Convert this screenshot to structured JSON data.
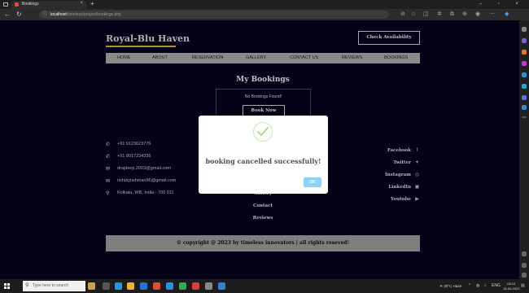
{
  "browser": {
    "tab_title": "Bookings",
    "tab_close": "×",
    "new_tab": "+",
    "window_controls": "– ▫ ×",
    "url_host": "localhost",
    "url_path": "/timeless/project/bookings.php",
    "url_info_icon": "info-icon"
  },
  "site": {
    "brand": "Royal-Blu Haven",
    "check_availability": "Check Availability",
    "nav": [
      "HOME",
      "ABOUT",
      "RESERVATION",
      "GALLERY",
      "CONTACT US",
      "REVIEWS",
      "BOOKINGS"
    ],
    "heading": "My Bookings",
    "no_bookings": "No Bookings Found!",
    "book_now": "Book Now",
    "contact": [
      {
        "icon": "phone-icon",
        "text": "+91 9123623776"
      },
      {
        "icon": "phone-icon",
        "text": "+91 8017234356"
      },
      {
        "icon": "mail-icon",
        "text": "drajdeep.2003@gmail.com"
      },
      {
        "icon": "mail-icon",
        "text": "rishiayushman96@gmail.com"
      },
      {
        "icon": "location-icon",
        "text": "Kolkata, WB, India - 700 011"
      }
    ],
    "footer_links": [
      "Gallery",
      "Contact",
      "Reviews"
    ],
    "social": [
      {
        "label": "Facebook",
        "icon": "facebook-icon"
      },
      {
        "label": "Twitter",
        "icon": "twitter-icon"
      },
      {
        "label": "Instagram",
        "icon": "instagram-icon"
      },
      {
        "label": "LinkedIn",
        "icon": "linkedin-icon"
      },
      {
        "label": "Youtube",
        "icon": "youtube-icon"
      }
    ],
    "copyright": "© copyright @ 2023 by timeless innovators | all rights reseved!"
  },
  "modal": {
    "message": "booking cancelled successfully!",
    "ok_label": "OK",
    "icon": "success-check-icon"
  },
  "taskbar": {
    "search_placeholder": "Type here to search",
    "weather": "20°C Haze",
    "time": "08:10",
    "date": "15-04-2023",
    "lang": "ENG"
  },
  "colors": {
    "page_bg": "#070320",
    "brand_underline": "#e1c438",
    "nav_bg": "#b9b9b9",
    "footer_bg": "#a8a8a8",
    "ok_button": "#8cd4f5",
    "success_check": "#a5dc86"
  }
}
